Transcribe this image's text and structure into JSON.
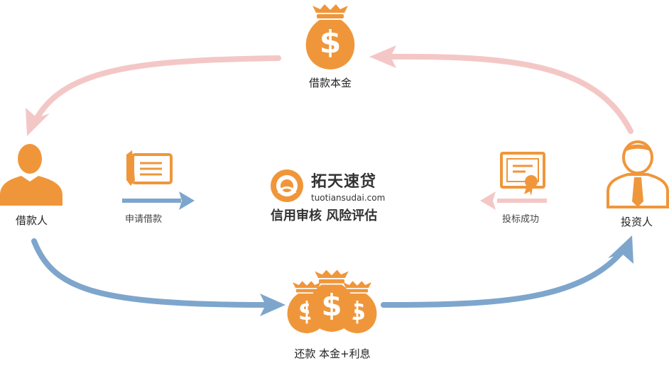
{
  "labels": {
    "top_bag": "借款本金",
    "borrower": "借款人",
    "investor": "投资人",
    "apply": "申请借款",
    "bid_success": "投标成功",
    "bottom_bags": "还款 本金+利息"
  },
  "brand": {
    "name": "拓天速贷",
    "url": "tuotiansudai.com",
    "slogan": "信用审核 风险评估"
  },
  "colors": {
    "orange": "#F0963A",
    "pink": "#F4C7C7",
    "blue": "#7EA6CC",
    "dollar": "#ffffff"
  },
  "icons": [
    "money-bag-icon",
    "person-icon",
    "businessman-icon",
    "document-pen-icon",
    "certificate-icon",
    "brand-logo-icon"
  ]
}
